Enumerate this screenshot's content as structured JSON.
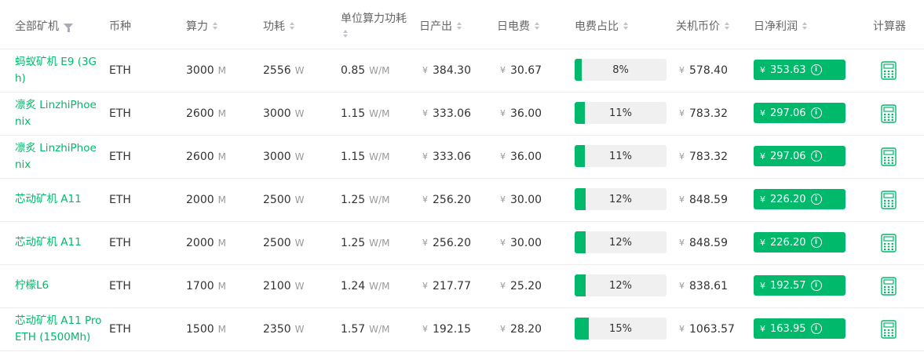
{
  "columns": {
    "all_miners": "全部矿机",
    "coin": "币种",
    "hashrate": "算力",
    "power": "功耗",
    "unit_efficiency": "单位算力功耗",
    "daily_output": "日产出",
    "daily_electricity": "日电费",
    "electricity_ratio": "电费占比",
    "shutdown_price": "关机币价",
    "daily_net_profit": "日净利润",
    "calculator": "计算器"
  },
  "units": {
    "hashrate": "M",
    "power": "W",
    "efficiency": "W/M",
    "currency": "¥"
  },
  "colors": {
    "accent": "#00b96b",
    "bar_track": "#f0f0f0"
  },
  "rows": [
    {
      "name": "蚂蚁矿机 E9 (3Gh)",
      "coin": "ETH",
      "hashrate": "3000",
      "power": "2556",
      "efficiency": "0.85",
      "daily_output": "384.30",
      "daily_electricity": "30.67",
      "ratio_label": "8%",
      "ratio": 0.08,
      "shutdown_price": "578.40",
      "net_profit": "353.63"
    },
    {
      "name": "凛炙 LinzhiPhoenix",
      "coin": "ETH",
      "hashrate": "2600",
      "power": "3000",
      "efficiency": "1.15",
      "daily_output": "333.06",
      "daily_electricity": "36.00",
      "ratio_label": "11%",
      "ratio": 0.11,
      "shutdown_price": "783.32",
      "net_profit": "297.06"
    },
    {
      "name": "凛炙 LinzhiPhoenix",
      "coin": "ETH",
      "hashrate": "2600",
      "power": "3000",
      "efficiency": "1.15",
      "daily_output": "333.06",
      "daily_electricity": "36.00",
      "ratio_label": "11%",
      "ratio": 0.11,
      "shutdown_price": "783.32",
      "net_profit": "297.06"
    },
    {
      "name": "芯动矿机 A11",
      "coin": "ETH",
      "hashrate": "2000",
      "power": "2500",
      "efficiency": "1.25",
      "daily_output": "256.20",
      "daily_electricity": "30.00",
      "ratio_label": "12%",
      "ratio": 0.12,
      "shutdown_price": "848.59",
      "net_profit": "226.20"
    },
    {
      "name": "芯动矿机 A11",
      "coin": "ETH",
      "hashrate": "2000",
      "power": "2500",
      "efficiency": "1.25",
      "daily_output": "256.20",
      "daily_electricity": "30.00",
      "ratio_label": "12%",
      "ratio": 0.12,
      "shutdown_price": "848.59",
      "net_profit": "226.20"
    },
    {
      "name": "柠檬L6",
      "coin": "ETH",
      "hashrate": "1700",
      "power": "2100",
      "efficiency": "1.24",
      "daily_output": "217.77",
      "daily_electricity": "25.20",
      "ratio_label": "12%",
      "ratio": 0.12,
      "shutdown_price": "838.61",
      "net_profit": "192.57"
    },
    {
      "name": "芯动矿机 A11 Pro ETH (1500Mh)",
      "coin": "ETH",
      "hashrate": "1500",
      "power": "2350",
      "efficiency": "1.57",
      "daily_output": "192.15",
      "daily_electricity": "28.20",
      "ratio_label": "15%",
      "ratio": 0.15,
      "shutdown_price": "1063.57",
      "net_profit": "163.95"
    }
  ]
}
